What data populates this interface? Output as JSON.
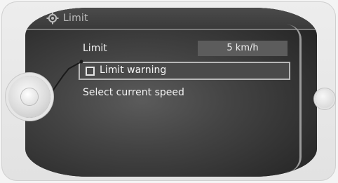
{
  "header": {
    "title": "Limit"
  },
  "menu": {
    "limit_label": "Limit",
    "limit_value": "5 km/h",
    "warning_label": "Limit warning",
    "select_speed_label": "Select current speed"
  },
  "icons": {
    "title_icon": "gear-icon",
    "checkbox": "checkbox-icon"
  }
}
